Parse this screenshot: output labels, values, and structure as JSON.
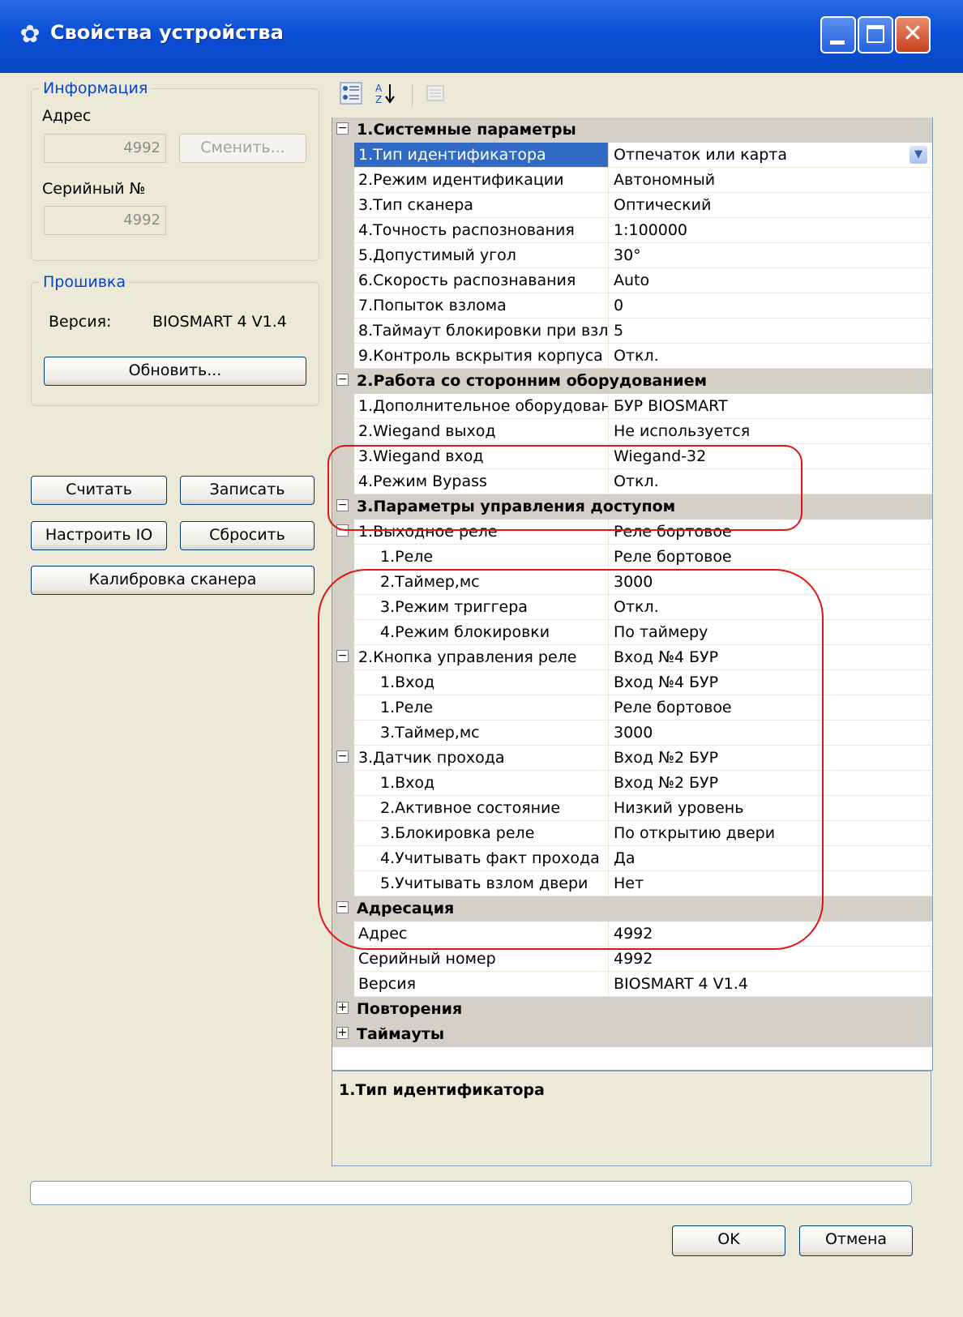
{
  "window": {
    "title": "Свойства устройства",
    "icon": "gear-icon"
  },
  "info_group": {
    "legend": "Информация",
    "address_label": "Адрес",
    "address_value": "4992",
    "change_button": "Сменить...",
    "serial_label": "Серийный №",
    "serial_value": "4992"
  },
  "firmware_group": {
    "legend": "Прошивка",
    "version_label": "Версия:",
    "version_value": "BIOSMART 4 V1.4",
    "update_button": "Обновить..."
  },
  "actions": {
    "read": "Считать",
    "write": "Записать",
    "configure_io": "Настроить IO",
    "reset": "Сбросить",
    "calibrate": "Калибровка сканера"
  },
  "grid_rows": [
    {
      "type": "cat",
      "expander": "⊟",
      "label": "1.Системные параметры"
    },
    {
      "type": "prop",
      "name": "1.Тип идентификатора",
      "value": "Отпечаток или карта",
      "selected": true,
      "dropdown": true
    },
    {
      "type": "prop",
      "name": "2.Режим идентификации",
      "value": "Автономный"
    },
    {
      "type": "prop",
      "name": "3.Тип сканера",
      "value": "Оптический"
    },
    {
      "type": "prop",
      "name": "4.Точность распознования",
      "value": "1:100000"
    },
    {
      "type": "prop",
      "name": "5.Допустимый угол",
      "value": "30°"
    },
    {
      "type": "prop",
      "name": "6.Скорость распознавания",
      "value": "Auto"
    },
    {
      "type": "prop",
      "name": "7.Попыток взлома",
      "value": "0"
    },
    {
      "type": "prop",
      "name": "8.Таймаут блокировки при взло",
      "value": "5"
    },
    {
      "type": "prop",
      "name": "9.Контроль вскрытия корпуса",
      "value": "Откл."
    },
    {
      "type": "cat",
      "expander": "⊟",
      "label": "2.Работа со сторонним оборудованием"
    },
    {
      "type": "prop",
      "name": "1.Дополнительное оборудовани",
      "value": "БУР BIOSMART"
    },
    {
      "type": "prop",
      "name": "2.Wiegand выход",
      "value": "Не используется"
    },
    {
      "type": "prop",
      "name": "3.Wiegand вход",
      "value": "Wiegand-32"
    },
    {
      "type": "prop",
      "name": "4.Режим Bypass",
      "value": "Откл."
    },
    {
      "type": "cat",
      "expander": "⊟",
      "label": "3.Параметры управления доступом"
    },
    {
      "type": "prop",
      "name": "1.Выходное реле",
      "value": "Реле бортовое",
      "expander": "⊟"
    },
    {
      "type": "prop",
      "name": "1.Реле",
      "value": "Реле бортовое",
      "sub": true
    },
    {
      "type": "prop",
      "name": "2.Таймер,мс",
      "value": "3000",
      "sub": true
    },
    {
      "type": "prop",
      "name": "3.Режим триггера",
      "value": "Откл.",
      "sub": true
    },
    {
      "type": "prop",
      "name": "4.Режим блокировки",
      "value": "По таймеру",
      "sub": true
    },
    {
      "type": "prop",
      "name": "2.Кнопка управления реле",
      "value": "Вход №4 БУР",
      "expander": "⊟"
    },
    {
      "type": "prop",
      "name": "1.Вход",
      "value": "Вход №4 БУР",
      "sub": true
    },
    {
      "type": "prop",
      "name": "1.Реле",
      "value": "Реле бортовое",
      "sub": true
    },
    {
      "type": "prop",
      "name": "3.Таймер,мс",
      "value": "3000",
      "sub": true
    },
    {
      "type": "prop",
      "name": "3.Датчик прохода",
      "value": "Вход №2 БУР",
      "expander": "⊟"
    },
    {
      "type": "prop",
      "name": "1.Вход",
      "value": "Вход №2 БУР",
      "sub": true
    },
    {
      "type": "prop",
      "name": "2.Активное состояние",
      "value": "Низкий уровень",
      "sub": true
    },
    {
      "type": "prop",
      "name": "3.Блокировка реле",
      "value": "По открытию двери",
      "sub": true
    },
    {
      "type": "prop",
      "name": "4.Учитывать факт прохода",
      "value": "Да",
      "sub": true
    },
    {
      "type": "prop",
      "name": "5.Учитывать взлом двери",
      "value": "Нет",
      "sub": true
    },
    {
      "type": "cat",
      "expander": "⊟",
      "label": "Адресация"
    },
    {
      "type": "prop",
      "name": "Адрес",
      "value": "4992"
    },
    {
      "type": "prop",
      "name": "Серийный номер",
      "value": "4992"
    },
    {
      "type": "prop",
      "name": "Версия",
      "value": "BIOSMART 4 V1.4"
    },
    {
      "type": "cat",
      "expander": "⊞",
      "label": "Повторения"
    },
    {
      "type": "cat",
      "expander": "⊞",
      "label": "Таймауты"
    }
  ],
  "description": {
    "title": "1.Тип идентификатора"
  },
  "footer": {
    "ok": "OK",
    "cancel": "Отмена"
  },
  "colors": {
    "titlebar": "#0a4fd6",
    "selection": "#316ac5",
    "annotation": "#e01616"
  }
}
